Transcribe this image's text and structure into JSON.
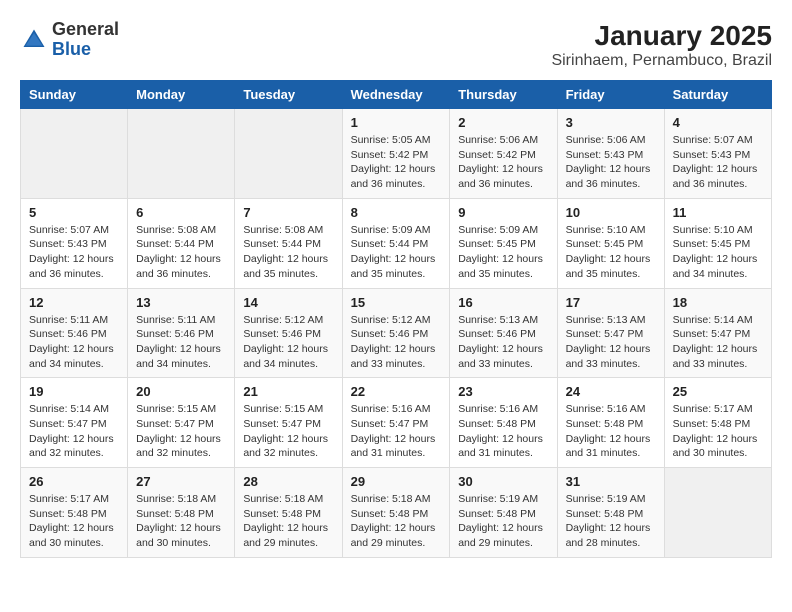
{
  "header": {
    "logo_general": "General",
    "logo_blue": "Blue",
    "title": "January 2025",
    "subtitle": "Sirinhaem, Pernambuco, Brazil"
  },
  "days_of_week": [
    "Sunday",
    "Monday",
    "Tuesday",
    "Wednesday",
    "Thursday",
    "Friday",
    "Saturday"
  ],
  "weeks": [
    [
      {
        "day": "",
        "info": ""
      },
      {
        "day": "",
        "info": ""
      },
      {
        "day": "",
        "info": ""
      },
      {
        "day": "1",
        "info": "Sunrise: 5:05 AM\nSunset: 5:42 PM\nDaylight: 12 hours\nand 36 minutes."
      },
      {
        "day": "2",
        "info": "Sunrise: 5:06 AM\nSunset: 5:42 PM\nDaylight: 12 hours\nand 36 minutes."
      },
      {
        "day": "3",
        "info": "Sunrise: 5:06 AM\nSunset: 5:43 PM\nDaylight: 12 hours\nand 36 minutes."
      },
      {
        "day": "4",
        "info": "Sunrise: 5:07 AM\nSunset: 5:43 PM\nDaylight: 12 hours\nand 36 minutes."
      }
    ],
    [
      {
        "day": "5",
        "info": "Sunrise: 5:07 AM\nSunset: 5:43 PM\nDaylight: 12 hours\nand 36 minutes."
      },
      {
        "day": "6",
        "info": "Sunrise: 5:08 AM\nSunset: 5:44 PM\nDaylight: 12 hours\nand 36 minutes."
      },
      {
        "day": "7",
        "info": "Sunrise: 5:08 AM\nSunset: 5:44 PM\nDaylight: 12 hours\nand 35 minutes."
      },
      {
        "day": "8",
        "info": "Sunrise: 5:09 AM\nSunset: 5:44 PM\nDaylight: 12 hours\nand 35 minutes."
      },
      {
        "day": "9",
        "info": "Sunrise: 5:09 AM\nSunset: 5:45 PM\nDaylight: 12 hours\nand 35 minutes."
      },
      {
        "day": "10",
        "info": "Sunrise: 5:10 AM\nSunset: 5:45 PM\nDaylight: 12 hours\nand 35 minutes."
      },
      {
        "day": "11",
        "info": "Sunrise: 5:10 AM\nSunset: 5:45 PM\nDaylight: 12 hours\nand 34 minutes."
      }
    ],
    [
      {
        "day": "12",
        "info": "Sunrise: 5:11 AM\nSunset: 5:46 PM\nDaylight: 12 hours\nand 34 minutes."
      },
      {
        "day": "13",
        "info": "Sunrise: 5:11 AM\nSunset: 5:46 PM\nDaylight: 12 hours\nand 34 minutes."
      },
      {
        "day": "14",
        "info": "Sunrise: 5:12 AM\nSunset: 5:46 PM\nDaylight: 12 hours\nand 34 minutes."
      },
      {
        "day": "15",
        "info": "Sunrise: 5:12 AM\nSunset: 5:46 PM\nDaylight: 12 hours\nand 33 minutes."
      },
      {
        "day": "16",
        "info": "Sunrise: 5:13 AM\nSunset: 5:46 PM\nDaylight: 12 hours\nand 33 minutes."
      },
      {
        "day": "17",
        "info": "Sunrise: 5:13 AM\nSunset: 5:47 PM\nDaylight: 12 hours\nand 33 minutes."
      },
      {
        "day": "18",
        "info": "Sunrise: 5:14 AM\nSunset: 5:47 PM\nDaylight: 12 hours\nand 33 minutes."
      }
    ],
    [
      {
        "day": "19",
        "info": "Sunrise: 5:14 AM\nSunset: 5:47 PM\nDaylight: 12 hours\nand 32 minutes."
      },
      {
        "day": "20",
        "info": "Sunrise: 5:15 AM\nSunset: 5:47 PM\nDaylight: 12 hours\nand 32 minutes."
      },
      {
        "day": "21",
        "info": "Sunrise: 5:15 AM\nSunset: 5:47 PM\nDaylight: 12 hours\nand 32 minutes."
      },
      {
        "day": "22",
        "info": "Sunrise: 5:16 AM\nSunset: 5:47 PM\nDaylight: 12 hours\nand 31 minutes."
      },
      {
        "day": "23",
        "info": "Sunrise: 5:16 AM\nSunset: 5:48 PM\nDaylight: 12 hours\nand 31 minutes."
      },
      {
        "day": "24",
        "info": "Sunrise: 5:16 AM\nSunset: 5:48 PM\nDaylight: 12 hours\nand 31 minutes."
      },
      {
        "day": "25",
        "info": "Sunrise: 5:17 AM\nSunset: 5:48 PM\nDaylight: 12 hours\nand 30 minutes."
      }
    ],
    [
      {
        "day": "26",
        "info": "Sunrise: 5:17 AM\nSunset: 5:48 PM\nDaylight: 12 hours\nand 30 minutes."
      },
      {
        "day": "27",
        "info": "Sunrise: 5:18 AM\nSunset: 5:48 PM\nDaylight: 12 hours\nand 30 minutes."
      },
      {
        "day": "28",
        "info": "Sunrise: 5:18 AM\nSunset: 5:48 PM\nDaylight: 12 hours\nand 29 minutes."
      },
      {
        "day": "29",
        "info": "Sunrise: 5:18 AM\nSunset: 5:48 PM\nDaylight: 12 hours\nand 29 minutes."
      },
      {
        "day": "30",
        "info": "Sunrise: 5:19 AM\nSunset: 5:48 PM\nDaylight: 12 hours\nand 29 minutes."
      },
      {
        "day": "31",
        "info": "Sunrise: 5:19 AM\nSunset: 5:48 PM\nDaylight: 12 hours\nand 28 minutes."
      },
      {
        "day": "",
        "info": ""
      }
    ]
  ]
}
